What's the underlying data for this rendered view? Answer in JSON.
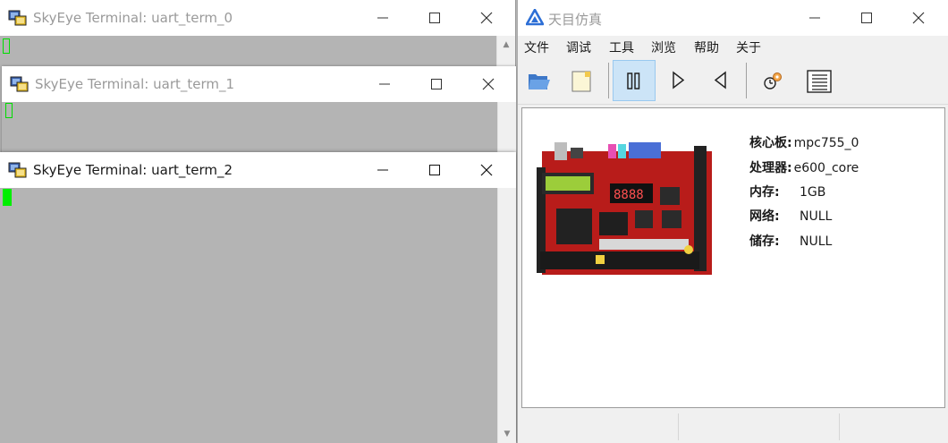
{
  "terminals": [
    {
      "title": "SkyEye Terminal: uart_term_0"
    },
    {
      "title": "SkyEye Terminal: uart_term_1"
    },
    {
      "title": "SkyEye Terminal: uart_term_2"
    }
  ],
  "app": {
    "title": "天目仿真",
    "menu": [
      "文件",
      "调试",
      "工具",
      "浏览",
      "帮助",
      "关于"
    ],
    "toolbar": {
      "open": "folder-open-icon",
      "new": "new-file-icon",
      "pause": "pause-icon",
      "run": "play-icon",
      "step_back": "step-back-icon",
      "settings": "timer-settings-icon",
      "log": "list-icon"
    },
    "info": [
      {
        "label": "核心板:",
        "value": "mpc755_0"
      },
      {
        "label": "处理器:",
        "value": "e600_core"
      },
      {
        "label": "内存:",
        "value": "1GB"
      },
      {
        "label": "网络:",
        "value": "NULL"
      },
      {
        "label": "储存:",
        "value": "NULL"
      }
    ]
  },
  "colors": {
    "terminal_bg": "#b4b4b4",
    "cursor": "#00ee00",
    "pressed_bg": "#cce4f7",
    "board_red": "#c8201e"
  }
}
